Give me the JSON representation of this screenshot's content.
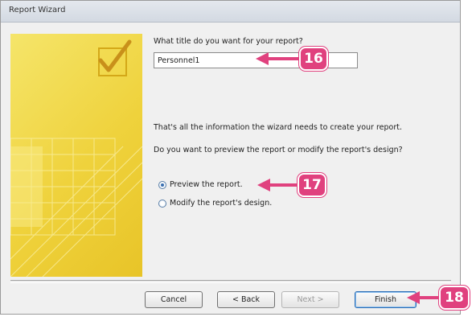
{
  "window": {
    "title": "Report Wizard"
  },
  "prompt": {
    "question": "What title do you want for your report?",
    "title_value": "Personnel1"
  },
  "info": {
    "line1": "That's all the information the wizard needs to create your report.",
    "line2": "Do you want to preview the report or modify the report's design?"
  },
  "options": [
    {
      "label": "Preview the report.",
      "selected": true
    },
    {
      "label": "Modify the report's design.",
      "selected": false
    }
  ],
  "buttons": {
    "cancel": "Cancel",
    "back": "< Back",
    "next": "Next >",
    "finish": "Finish"
  },
  "callouts": [
    {
      "number": "16"
    },
    {
      "number": "17"
    },
    {
      "number": "18"
    }
  ],
  "colors": {
    "callout": "#e0417e",
    "art_yellow": "#efd23c"
  }
}
